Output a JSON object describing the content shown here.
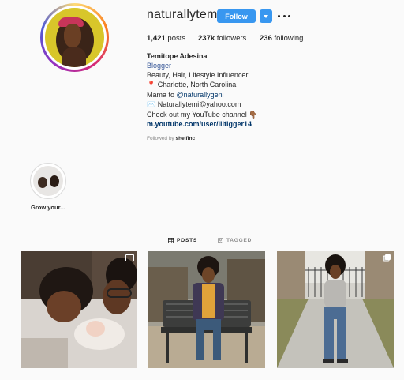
{
  "profile": {
    "username": "naturallytemi",
    "follow_label": "Follow",
    "stats": {
      "posts_count": "1,421",
      "posts_label": "posts",
      "followers_count": "237k",
      "followers_label": "followers",
      "following_count": "236",
      "following_label": "following"
    },
    "bio": {
      "name": "Temitope Adesina",
      "category": "Blogger",
      "line1": "Beauty, Hair, Lifestyle Influencer",
      "line2_icon": "📍",
      "line2": "Charlotte, North Carolina",
      "line3_prefix": "Mama to ",
      "line3_mention": "@naturallygeni",
      "line4_icon": "✉️",
      "line4": "Naturallytemi@yahoo.com",
      "line5": "Check out my YouTube channel",
      "line5_icon": "👇🏾",
      "url": "m.youtube.com/user/liltigger14"
    },
    "followed_by_prefix": "Followed by",
    "followed_by_user": "shelfinc"
  },
  "highlights": [
    {
      "label": "Grow your..."
    }
  ],
  "tabs": {
    "posts": "POSTS",
    "tagged": "TAGGED"
  },
  "icons": {
    "more": "more-options-icon",
    "dropdown": "chevron-down-icon",
    "posts_tab": "grid-icon",
    "tagged_tab": "tag-icon",
    "video": "igtv-icon",
    "carousel": "carousel-icon"
  },
  "colors": {
    "accent": "#3897f0",
    "link": "#003569",
    "muted": "#8e8e8e",
    "background": "#fafafa"
  }
}
